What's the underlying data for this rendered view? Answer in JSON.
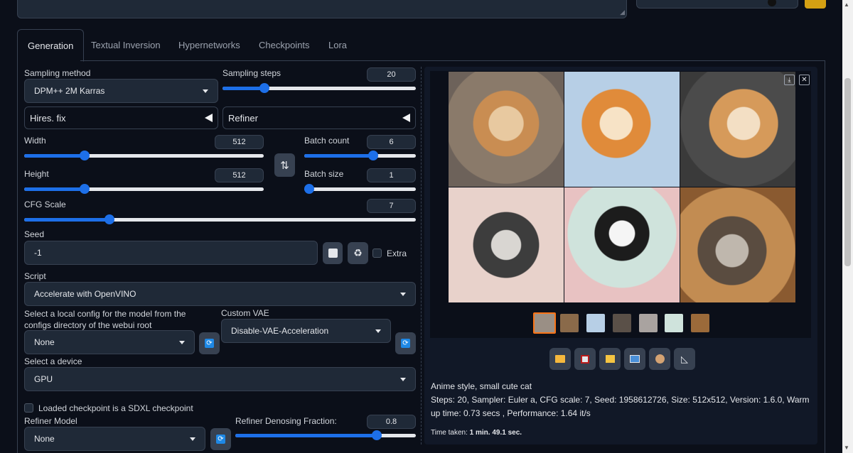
{
  "tabs": [
    {
      "label": "Generation",
      "active": true
    },
    {
      "label": "Textual Inversion",
      "active": false
    },
    {
      "label": "Hypernetworks",
      "active": false
    },
    {
      "label": "Checkpoints",
      "active": false
    },
    {
      "label": "Lora",
      "active": false
    }
  ],
  "sampling": {
    "method_label": "Sampling method",
    "method_value": "DPM++ 2M Karras",
    "steps_label": "Sampling steps",
    "steps_value": "20",
    "steps_fraction": 0.2
  },
  "accordions": {
    "hires_label": "Hires. fix",
    "refiner_label": "Refiner"
  },
  "dims": {
    "width_label": "Width",
    "width_value": "512",
    "width_fraction": 0.24,
    "height_label": "Height",
    "height_value": "512",
    "height_fraction": 0.24,
    "batch_count_label": "Batch count",
    "batch_count_value": "6",
    "batch_count_fraction": 0.63,
    "batch_size_label": "Batch size",
    "batch_size_value": "1",
    "batch_size_fraction": 0.0,
    "swap_icon": "swap-vertical-icon"
  },
  "cfg": {
    "label": "CFG Scale",
    "value": "7",
    "fraction": 0.21
  },
  "seed": {
    "label": "Seed",
    "value": "-1",
    "extra_label": "Extra"
  },
  "script": {
    "label": "Script",
    "value": "Accelerate with OpenVINO"
  },
  "openvino": {
    "config_label": "Select a local config for the model from the configs directory of the webui root",
    "config_value": "None",
    "vae_label": "Custom VAE",
    "vae_value": "Disable-VAE-Acceleration",
    "device_label": "Select a device",
    "device_value": "GPU",
    "sdxl_label": "Loaded checkpoint is a SDXL checkpoint",
    "refiner_model_label": "Refiner Model",
    "refiner_model_value": "None",
    "refiner_frac_label": "Refiner Denosing Fraction:",
    "refiner_frac_value": "0.8",
    "refiner_frac_fraction": 0.8
  },
  "output": {
    "prompt": "Anime style, small cute cat",
    "params": "Steps: 20, Sampler: Euler a, CFG scale: 7, Seed: 1958612726, Size: 512x512, Version: 1.6.0, Warm up time: 0.73 secs , Performance: 1.64 it/s",
    "time_label": "Time taken:",
    "time_value": "1 min. 49.1 sec."
  },
  "tool_icons": [
    "folder-icon",
    "save-icon",
    "zip-icon",
    "image-icon",
    "palette-icon",
    "ruler-icon"
  ],
  "colors": {
    "accent": "#1d6fe8",
    "background": "#0b0f19",
    "panel": "#1f2937",
    "selected_thumb": "#f97316"
  }
}
